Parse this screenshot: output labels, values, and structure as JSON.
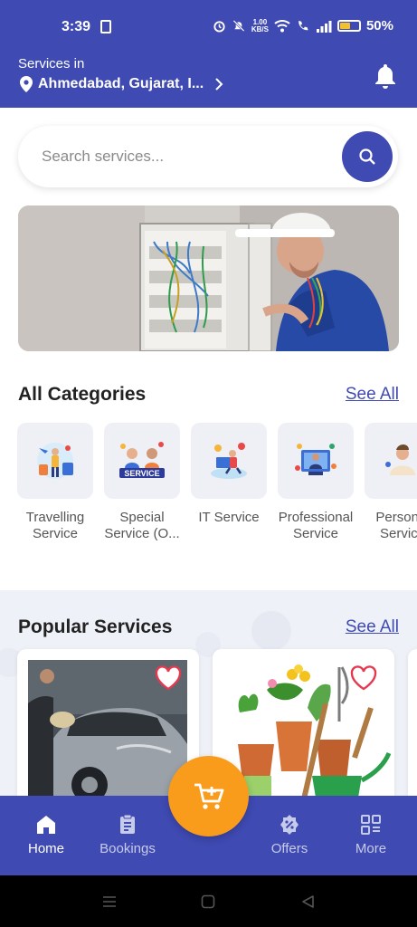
{
  "status_bar": {
    "time": "3:39",
    "net_speed_value": "1.00",
    "net_speed_unit": "KB/S",
    "battery_percent": "50%",
    "battery_level": 0.5
  },
  "header": {
    "label": "Services in",
    "location": "Ahmedabad, Gujarat, I..."
  },
  "search": {
    "placeholder": "Search services..."
  },
  "categories": {
    "title": "All Categories",
    "see_all": "See All",
    "items": [
      {
        "label": "Travelling Service",
        "icon": "travel-icon"
      },
      {
        "label": "Special Service (O...",
        "icon": "special-service-icon"
      },
      {
        "label": "IT Service",
        "icon": "it-service-icon"
      },
      {
        "label": "Professional Service",
        "icon": "professional-service-icon"
      },
      {
        "label": "Personal Service",
        "icon": "personal-service-icon"
      }
    ]
  },
  "popular": {
    "title": "Popular Services",
    "see_all": "See All"
  },
  "bottom_nav": {
    "items": [
      {
        "label": "Home",
        "icon": "home-icon",
        "active": true
      },
      {
        "label": "Bookings",
        "icon": "bookings-icon",
        "active": false
      },
      {
        "label": "Offers",
        "icon": "offers-icon",
        "active": false
      },
      {
        "label": "More",
        "icon": "more-icon",
        "active": false
      }
    ],
    "fab_icon": "add-to-cart-icon"
  },
  "colors": {
    "primary": "#3f4ab2",
    "accent": "#f99c1c",
    "heart": "#e53950"
  }
}
